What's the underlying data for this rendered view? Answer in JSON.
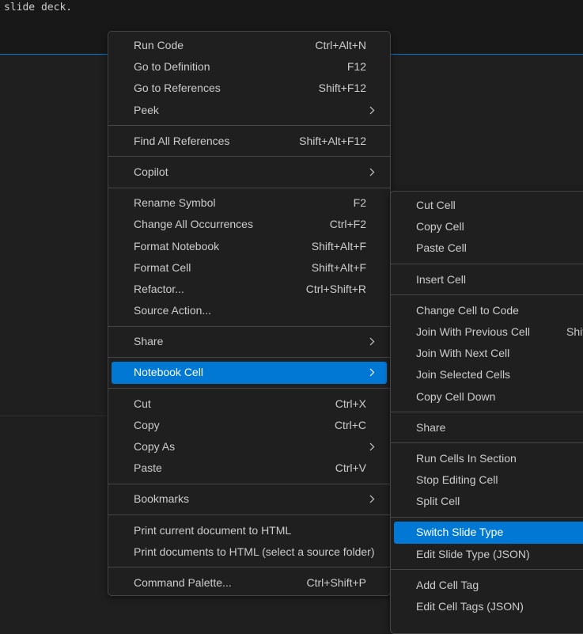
{
  "editor": {
    "text": "slide deck."
  },
  "context_menu": {
    "groups": [
      [
        {
          "label": "Run Code",
          "shortcut": "Ctrl+Alt+N"
        },
        {
          "label": "Go to Definition",
          "shortcut": "F12"
        },
        {
          "label": "Go to References",
          "shortcut": "Shift+F12"
        },
        {
          "label": "Peek",
          "submenu": true
        }
      ],
      [
        {
          "label": "Find All References",
          "shortcut": "Shift+Alt+F12"
        }
      ],
      [
        {
          "label": "Copilot",
          "submenu": true
        }
      ],
      [
        {
          "label": "Rename Symbol",
          "shortcut": "F2"
        },
        {
          "label": "Change All Occurrences",
          "shortcut": "Ctrl+F2"
        },
        {
          "label": "Format Notebook",
          "shortcut": "Shift+Alt+F"
        },
        {
          "label": "Format Cell",
          "shortcut": "Shift+Alt+F"
        },
        {
          "label": "Refactor...",
          "shortcut": "Ctrl+Shift+R"
        },
        {
          "label": "Source Action..."
        }
      ],
      [
        {
          "label": "Share",
          "submenu": true
        }
      ],
      [
        {
          "label": "Notebook Cell",
          "submenu": true,
          "active": true
        }
      ],
      [
        {
          "label": "Cut",
          "shortcut": "Ctrl+X"
        },
        {
          "label": "Copy",
          "shortcut": "Ctrl+C"
        },
        {
          "label": "Copy As",
          "submenu": true
        },
        {
          "label": "Paste",
          "shortcut": "Ctrl+V"
        }
      ],
      [
        {
          "label": "Bookmarks",
          "submenu": true
        }
      ],
      [
        {
          "label": "Print current document to HTML"
        },
        {
          "label": "Print documents to HTML (select a source folder)"
        }
      ],
      [
        {
          "label": "Command Palette...",
          "shortcut": "Ctrl+Shift+P"
        }
      ]
    ]
  },
  "notebook_cell_submenu": {
    "groups": [
      [
        {
          "label": "Cut Cell"
        },
        {
          "label": "Copy Cell"
        },
        {
          "label": "Paste Cell"
        }
      ],
      [
        {
          "label": "Insert Cell"
        }
      ],
      [
        {
          "label": "Change Cell to Code"
        },
        {
          "label": "Join With Previous Cell",
          "shortcut": "Shift"
        },
        {
          "label": "Join With Next Cell"
        },
        {
          "label": "Join Selected Cells"
        },
        {
          "label": "Copy Cell Down"
        }
      ],
      [
        {
          "label": "Share"
        }
      ],
      [
        {
          "label": "Run Cells In Section"
        },
        {
          "label": "Stop Editing Cell"
        },
        {
          "label": "Split Cell"
        }
      ],
      [
        {
          "label": "Switch Slide Type",
          "active": true
        },
        {
          "label": "Edit Slide Type (JSON)"
        }
      ],
      [
        {
          "label": "Add Cell Tag"
        },
        {
          "label": "Edit Cell Tags (JSON)"
        }
      ]
    ]
  },
  "colors": {
    "accent": "#0078d4",
    "menu_bg": "#1f1f1f",
    "menu_border": "#454545",
    "text": "#cccccc"
  }
}
